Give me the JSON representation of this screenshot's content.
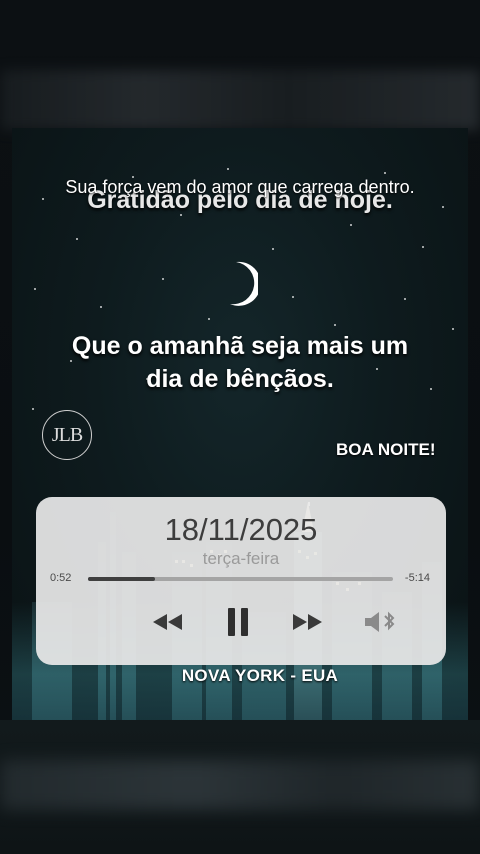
{
  "overlay": {
    "caption": "Sua força vem do amor que carrega dentro.",
    "title": "Gratidão pelo dia de hoje.",
    "message_line1": "Que o amanhã seja mais um",
    "message_line2": "dia de bênçãos.",
    "logo_text": "JLB",
    "greeting": "BOA NOITE!",
    "location": "NOVA YORK  - EUA"
  },
  "player": {
    "date": "18/11/2025",
    "weekday": "terça-feira",
    "elapsed": "0:52",
    "remaining": "-5:14",
    "progress": 0.22,
    "controls": {
      "prev_icon": "rewind-icon",
      "play_icon": "pause-icon",
      "next_icon": "fast-forward-icon",
      "output_icon": "speaker-bluetooth-icon"
    }
  },
  "colors": {
    "card": "#e8e8e8",
    "text_dark": "#3d3d3d",
    "text_muted": "#9a9a9a",
    "track": "#a4a4a4",
    "track_fill": "#3f3f3f"
  }
}
